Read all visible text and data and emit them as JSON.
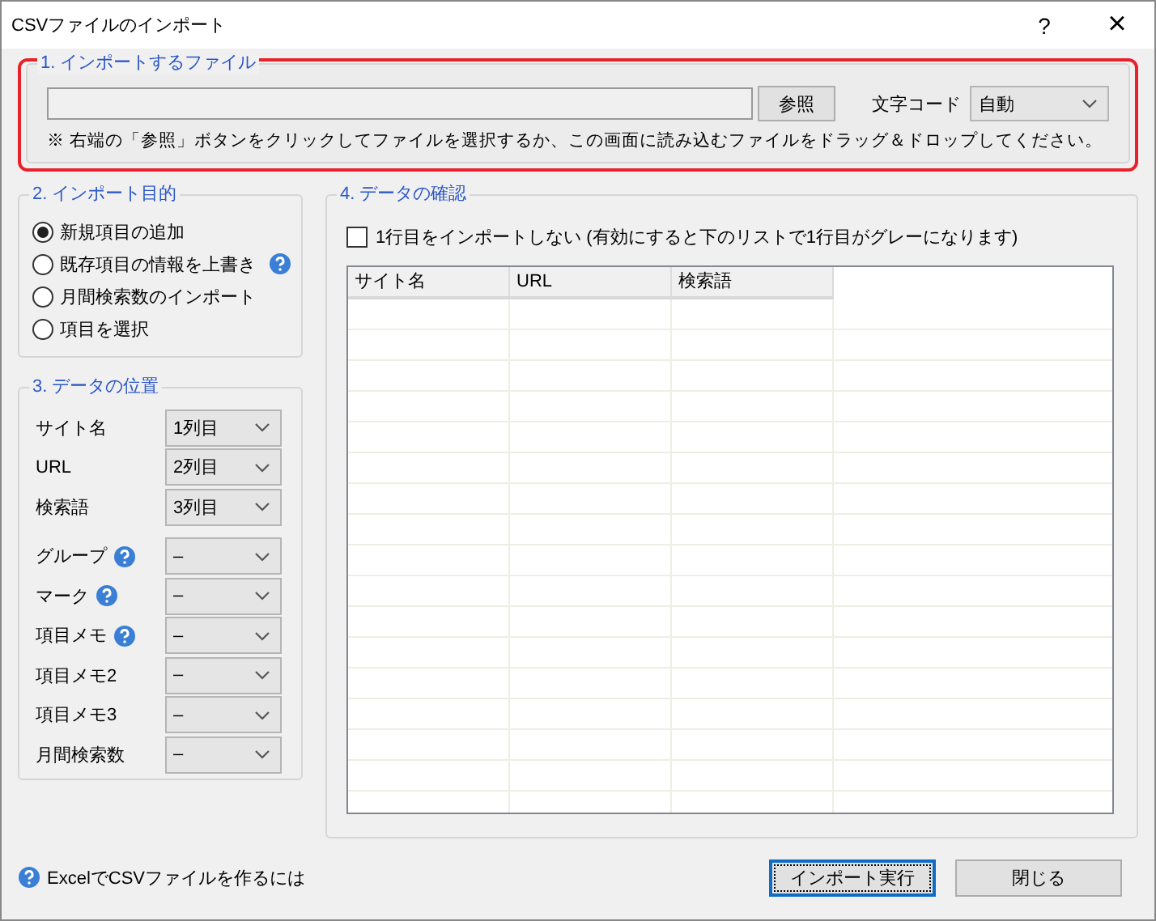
{
  "window": {
    "title": "CSVファイルのインポート",
    "help": "?",
    "close": "×"
  },
  "file_section": {
    "title": "1. インポートするファイル",
    "highlighted": true,
    "browse": "参照",
    "encoding_label": "文字コード",
    "encoding": "自動",
    "note": "※ 右端の「参照」ボタンをクリックしてファイルを選択するか、この画面に読み込むファイルをドラッグ＆ドロップしてください。"
  },
  "purpose_section": {
    "title": "2. インポート目的",
    "options": [
      {
        "label": "新規項目の追加",
        "selected": true,
        "help": false
      },
      {
        "label": "既存項目の情報を上書き",
        "selected": false,
        "help": true
      },
      {
        "label": "月間検索数のインポート",
        "selected": false,
        "help": false
      },
      {
        "label": "項目を選択",
        "selected": false,
        "help": false
      }
    ]
  },
  "position_section": {
    "title": "3. データの位置",
    "required_columns": [
      {
        "label": "サイト名",
        "value": "1列目",
        "help": false
      },
      {
        "label": "URL",
        "value": "2列目",
        "help": false
      },
      {
        "label": "検索語",
        "value": "3列目",
        "help": false
      }
    ],
    "optional_columns": [
      {
        "label": "グループ",
        "value": "–",
        "help": true
      },
      {
        "label": "マーク",
        "value": "–",
        "help": true
      },
      {
        "label": "項目メモ",
        "value": "–",
        "help": true
      },
      {
        "label": "項目メモ2",
        "value": "–",
        "help": false
      },
      {
        "label": "項目メモ3",
        "value": "–",
        "help": false
      },
      {
        "label": "月間検索数",
        "value": "–",
        "help": false
      }
    ]
  },
  "preview_section": {
    "title": "4. データの確認",
    "skip_first_row": {
      "label": "1行目をインポートしない (有効にすると下のリストで1行目がグレーになります)",
      "checked": false
    },
    "table": {
      "columns": [
        "サイト名",
        "URL",
        "検索語"
      ]
    }
  },
  "help_link": "ExcelでCSVファイルを作るには",
  "buttons": [
    {
      "label": "インポート実行",
      "focused": true
    },
    {
      "label": "閉じる",
      "focused": false
    }
  ]
}
